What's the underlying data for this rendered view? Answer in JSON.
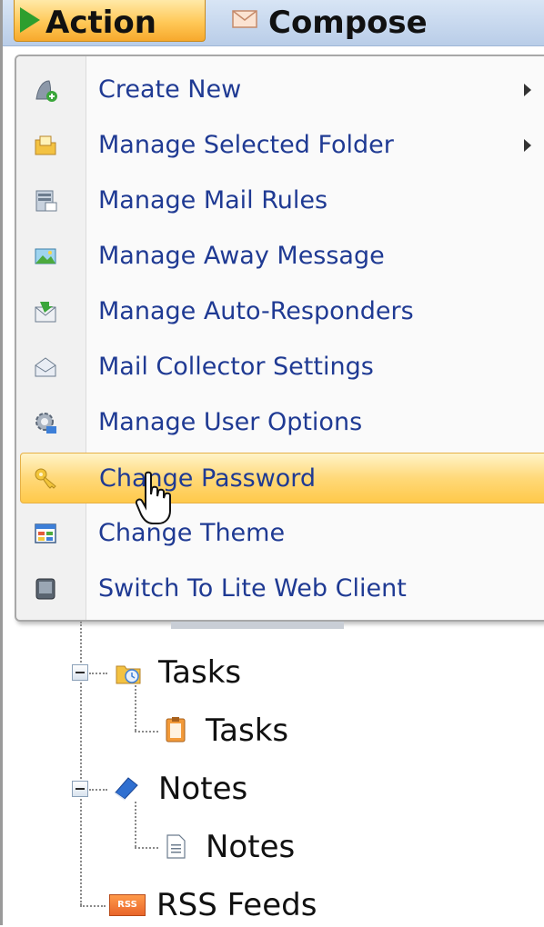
{
  "toolbar": {
    "action_label": "Action",
    "compose_label": "Compose"
  },
  "menu": {
    "items": [
      {
        "label": "Create New",
        "icon": "create-new-icon",
        "submenu": true
      },
      {
        "label": "Manage Selected Folder",
        "icon": "folder-icon",
        "submenu": true
      },
      {
        "label": "Manage Mail Rules",
        "icon": "mail-rules-icon",
        "submenu": false
      },
      {
        "label": "Manage Away Message",
        "icon": "away-message-icon",
        "submenu": false
      },
      {
        "label": "Manage Auto-Responders",
        "icon": "auto-responder-icon",
        "submenu": false
      },
      {
        "label": "Mail Collector Settings",
        "icon": "mail-collector-icon",
        "submenu": false
      },
      {
        "label": "Manage User Options",
        "icon": "user-options-icon",
        "submenu": false
      },
      {
        "label": "Change Password",
        "icon": "key-icon",
        "submenu": false,
        "highlighted": true
      },
      {
        "label": "Change Theme",
        "icon": "theme-icon",
        "submenu": false
      },
      {
        "label": "Switch To Lite Web Client",
        "icon": "lite-client-icon",
        "submenu": false
      }
    ]
  },
  "tree": {
    "tasks_group": "Tasks",
    "tasks_item": "Tasks",
    "notes_group": "Notes",
    "notes_item": "Notes",
    "rss": "RSS Feeds",
    "rss_badge": "RSS"
  },
  "colors": {
    "menu_text": "#1f3a93",
    "highlight": "#ffd979",
    "action_button": "#ffc857"
  }
}
